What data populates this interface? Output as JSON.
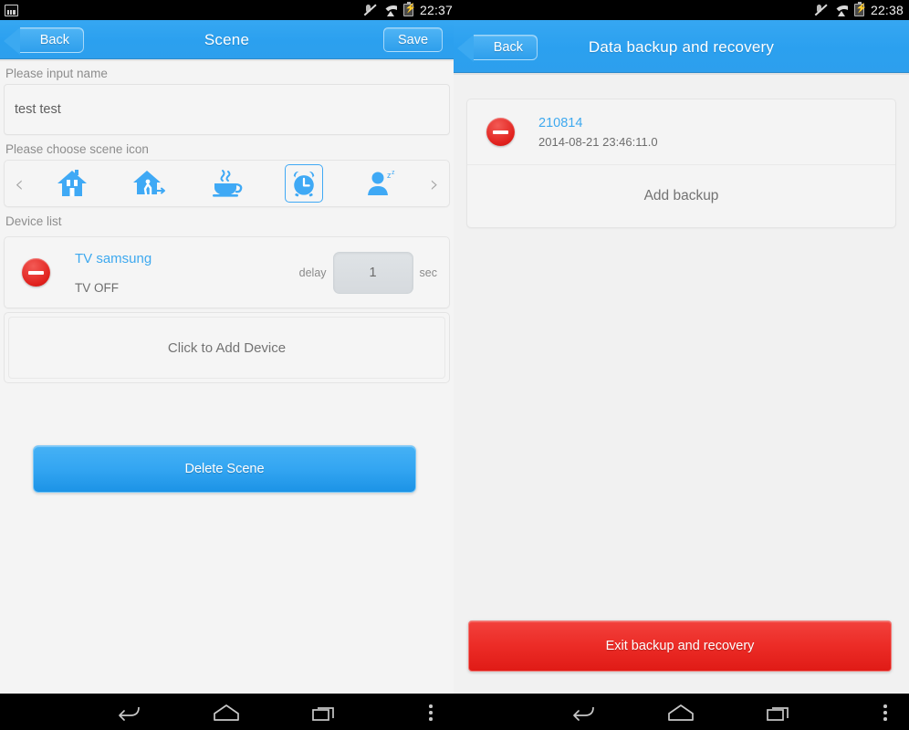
{
  "status_bar": {
    "left_notification_icon": "image-icon",
    "left_time": "22:37",
    "right_time": "22:38",
    "icons": [
      "mute-icon",
      "wifi-icon",
      "battery-charging-icon"
    ]
  },
  "left_panel": {
    "appbar": {
      "back_label": "Back",
      "title": "Scene",
      "save_label": "Save"
    },
    "name_section": {
      "label": "Please input name",
      "value": "test test",
      "placeholder": "Please input name"
    },
    "icon_section": {
      "label": "Please choose scene icon",
      "prev_arrow": "chevron-left-icon",
      "next_arrow": "chevron-right-icon",
      "icons": [
        {
          "name": "home-icon",
          "selected": false
        },
        {
          "name": "leave-home-icon",
          "selected": false
        },
        {
          "name": "coffee-cup-icon",
          "selected": false
        },
        {
          "name": "alarm-clock-icon",
          "selected": true
        },
        {
          "name": "sleeping-person-icon",
          "selected": false
        }
      ]
    },
    "device_section": {
      "label": "Device list",
      "devices": [
        {
          "name": "TV samsung",
          "state": "TV OFF",
          "delay_label": "delay",
          "delay_value": "1",
          "delay_unit": "sec",
          "delete_icon": "remove-circle-icon"
        }
      ],
      "add_device_label": "Click to Add Device"
    },
    "delete_scene_label": "Delete Scene"
  },
  "right_panel": {
    "appbar": {
      "back_label": "Back",
      "title": "Data backup and recovery"
    },
    "backups": [
      {
        "name": "210814",
        "timestamp": "2014-08-21 23:46:11.0",
        "delete_icon": "remove-circle-icon"
      }
    ],
    "add_backup_label": "Add backup",
    "exit_label": "Exit backup and recovery"
  },
  "nav_bar": {
    "buttons": [
      "back-nav-icon",
      "home-nav-icon",
      "recents-nav-icon",
      "overflow-menu-icon"
    ]
  },
  "colors": {
    "accent_blue": "#2ba0ef",
    "link_blue": "#3ea9ef",
    "danger_red": "#ec2c27",
    "page_bg": "#f4f4f4"
  }
}
